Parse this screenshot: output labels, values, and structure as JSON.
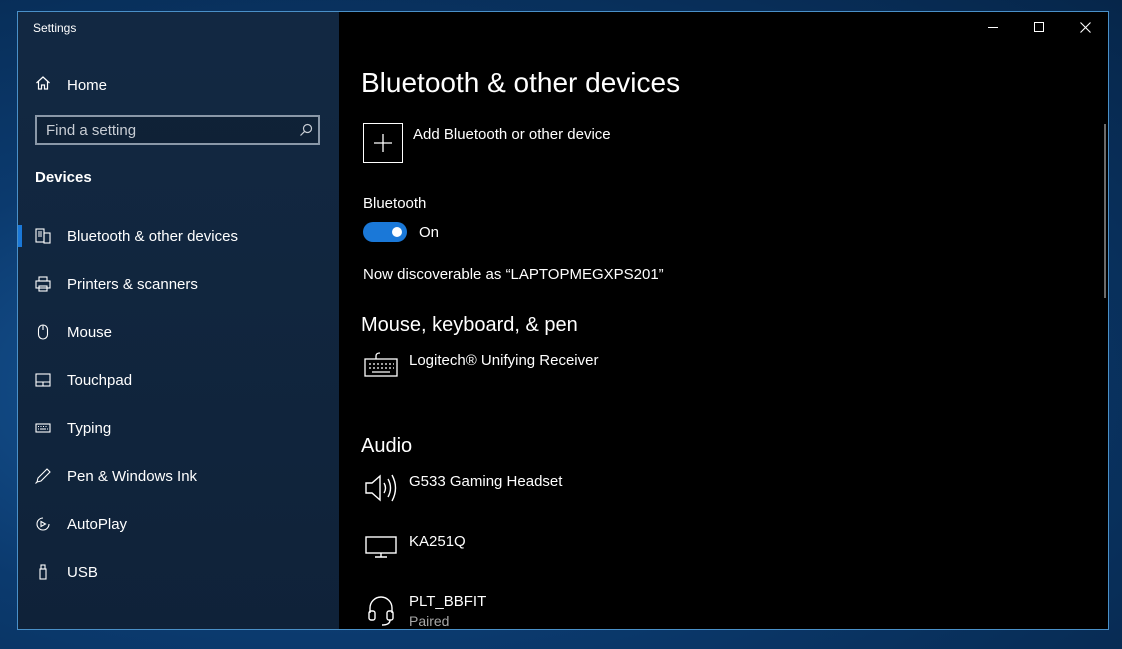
{
  "window": {
    "title": "Settings"
  },
  "sidebar": {
    "home_label": "Home",
    "search_placeholder": "Find a setting",
    "section": "Devices",
    "items": [
      {
        "label": "Bluetooth & other devices",
        "icon": "bluetooth-devices-icon",
        "active": true
      },
      {
        "label": "Printers & scanners",
        "icon": "printer-icon"
      },
      {
        "label": "Mouse",
        "icon": "mouse-icon"
      },
      {
        "label": "Touchpad",
        "icon": "touchpad-icon"
      },
      {
        "label": "Typing",
        "icon": "keyboard-icon"
      },
      {
        "label": "Pen & Windows Ink",
        "icon": "pen-icon"
      },
      {
        "label": "AutoPlay",
        "icon": "autoplay-icon"
      },
      {
        "label": "USB",
        "icon": "usb-icon"
      }
    ]
  },
  "content": {
    "title": "Bluetooth & other devices",
    "add_device_label": "Add Bluetooth or other device",
    "bluetooth_label": "Bluetooth",
    "bluetooth_state": "On",
    "discoverable_text": "Now discoverable as “LAPTOPMEGXPS201”",
    "groups": {
      "input": {
        "title": "Mouse, keyboard, & pen",
        "devices": [
          {
            "name": "Logitech® Unifying Receiver",
            "icon": "keyboard-icon"
          }
        ]
      },
      "audio": {
        "title": "Audio",
        "devices": [
          {
            "name": "G533 Gaming Headset",
            "icon": "speaker-icon"
          },
          {
            "name": "KA251Q",
            "icon": "monitor-icon"
          },
          {
            "name": "PLT_BBFIT",
            "status": "Paired",
            "icon": "headset-icon"
          }
        ]
      }
    }
  },
  "colors": {
    "accent": "#1a78d8",
    "sidebar_bg": "#142c48",
    "content_bg": "#000000"
  }
}
